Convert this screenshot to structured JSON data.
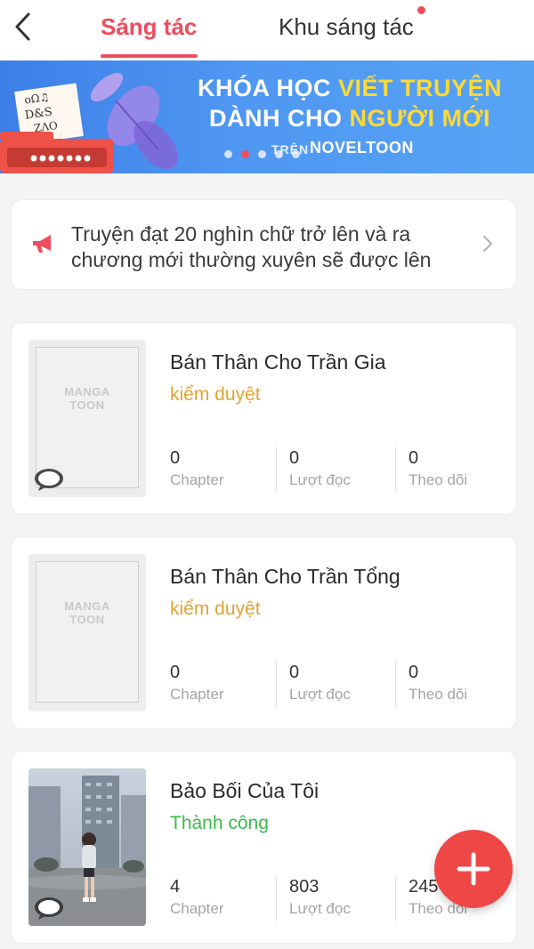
{
  "header": {
    "tab_active": "Sáng tác",
    "tab_other": "Khu sáng tác",
    "accent_color": "#ee4d5f"
  },
  "banner": {
    "line1_white": "KHÓA HỌC ",
    "line1_yellow": "VIẾT TRUYỆN",
    "line2_white": "DÀNH CHO ",
    "line2_yellow": "NGƯỜI MỚI",
    "sub_prefix": "TRÊN",
    "brand": "NOVELTOON",
    "dot_count": 5,
    "active_dot": 1
  },
  "notice": {
    "icon": "megaphone-icon",
    "text": "Truyện đạt 20 nghìn chữ trở lên và ra chương mới thường xuyên sẽ được lên"
  },
  "placeholder_logo": {
    "line1": "MANGA",
    "line2": "TOON"
  },
  "stories": [
    {
      "title": "Bán Thân Cho Trần Gia",
      "status": "kiểm duyệt",
      "status_color": "#e3a331",
      "has_comment_badge": true,
      "cover": "placeholder",
      "stats": [
        {
          "value": "0",
          "label": "Chapter"
        },
        {
          "value": "0",
          "label": "Lượt đọc"
        },
        {
          "value": "0",
          "label": "Theo dõi"
        }
      ]
    },
    {
      "title": "Bán Thân Cho Trần Tổng",
      "status": "kiểm duyệt",
      "status_color": "#e3a331",
      "has_comment_badge": false,
      "cover": "placeholder",
      "stats": [
        {
          "value": "0",
          "label": "Chapter"
        },
        {
          "value": "0",
          "label": "Lượt đọc"
        },
        {
          "value": "0",
          "label": "Theo dõi"
        }
      ]
    },
    {
      "title": "Bảo Bối Của Tôi",
      "status": "Thành công",
      "status_color": "#3cb94a",
      "has_comment_badge": true,
      "cover": "photo",
      "stats": [
        {
          "value": "4",
          "label": "Chapter"
        },
        {
          "value": "803",
          "label": "Lượt đọc"
        },
        {
          "value": "245",
          "label": "Theo dõi"
        }
      ]
    }
  ],
  "fab": {
    "icon": "plus-icon",
    "color": "#ef4646"
  }
}
